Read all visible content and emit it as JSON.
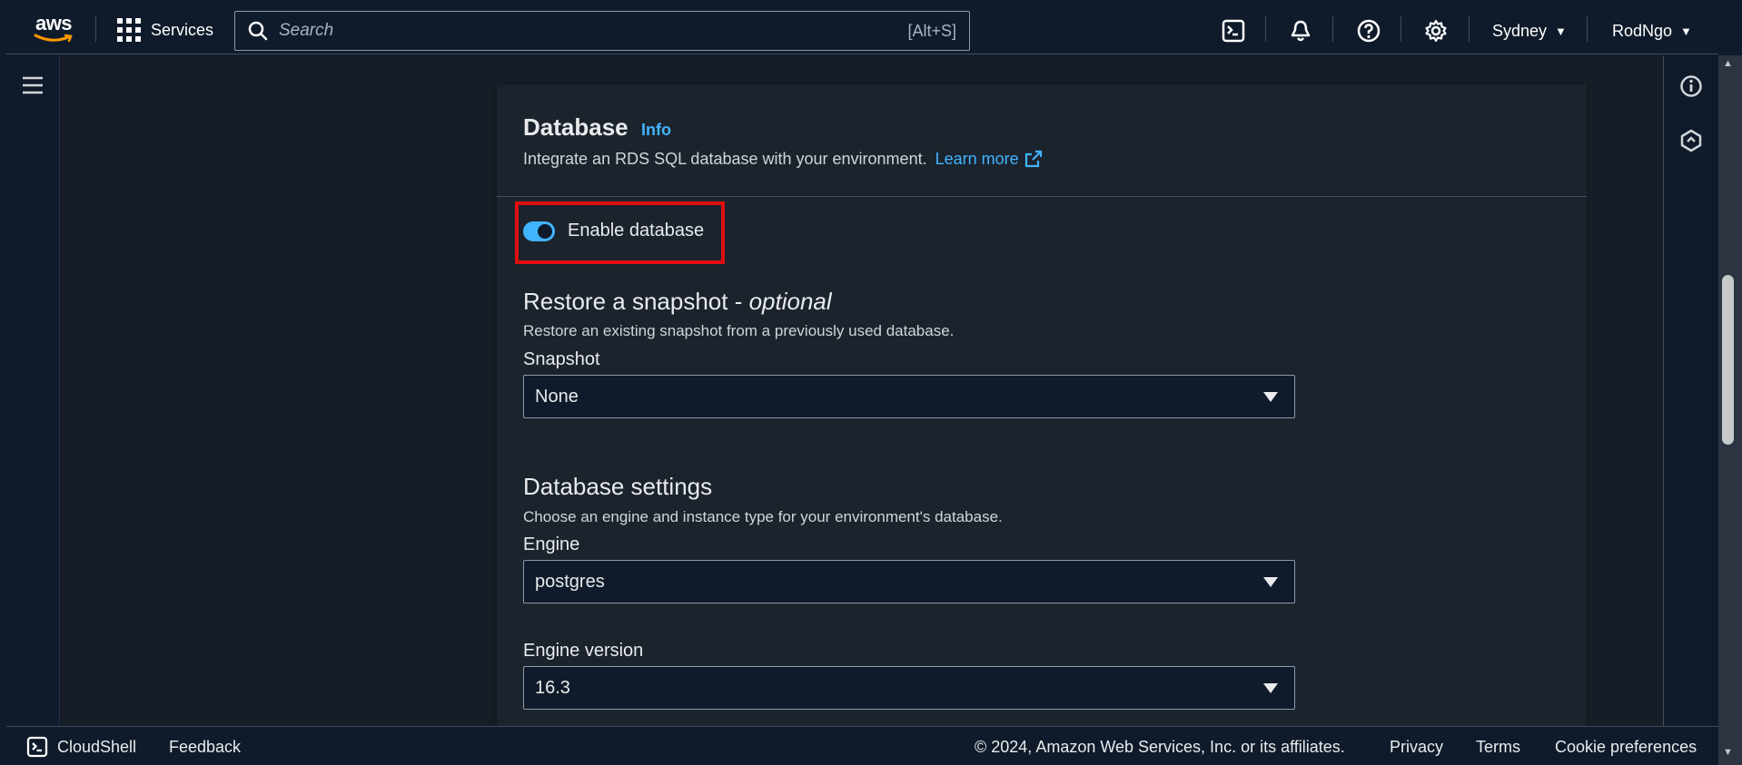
{
  "nav": {
    "logo_text": "aws",
    "services_label": "Services",
    "search_placeholder": "Search",
    "search_shortcut": "[Alt+S]",
    "region_label": "Sydney",
    "user_label": "RodNgo"
  },
  "section": {
    "title": "Database",
    "info_link": "Info",
    "description": "Integrate an RDS SQL database with your environment.",
    "learn_more": "Learn more"
  },
  "toggle": {
    "label": "Enable database",
    "enabled": true
  },
  "restore": {
    "title": "Restore a snapshot - ",
    "title_suffix": "optional",
    "description": "Restore an existing snapshot from a previously used database.",
    "snapshot_label": "Snapshot",
    "snapshot_value": "None"
  },
  "settings": {
    "title": "Database settings",
    "description": "Choose an engine and instance type for your environment's database.",
    "engine_label": "Engine",
    "engine_value": "postgres",
    "version_label": "Engine version",
    "version_value": "16.3"
  },
  "footer": {
    "cloudshell": "CloudShell",
    "feedback": "Feedback",
    "copyright": "© 2024, Amazon Web Services, Inc. or its affiliates.",
    "privacy": "Privacy",
    "terms": "Terms",
    "cookies": "Cookie preferences"
  },
  "colors": {
    "accent": "#42b4ff",
    "highlight": "#e00f0f",
    "background": "#161d26"
  }
}
